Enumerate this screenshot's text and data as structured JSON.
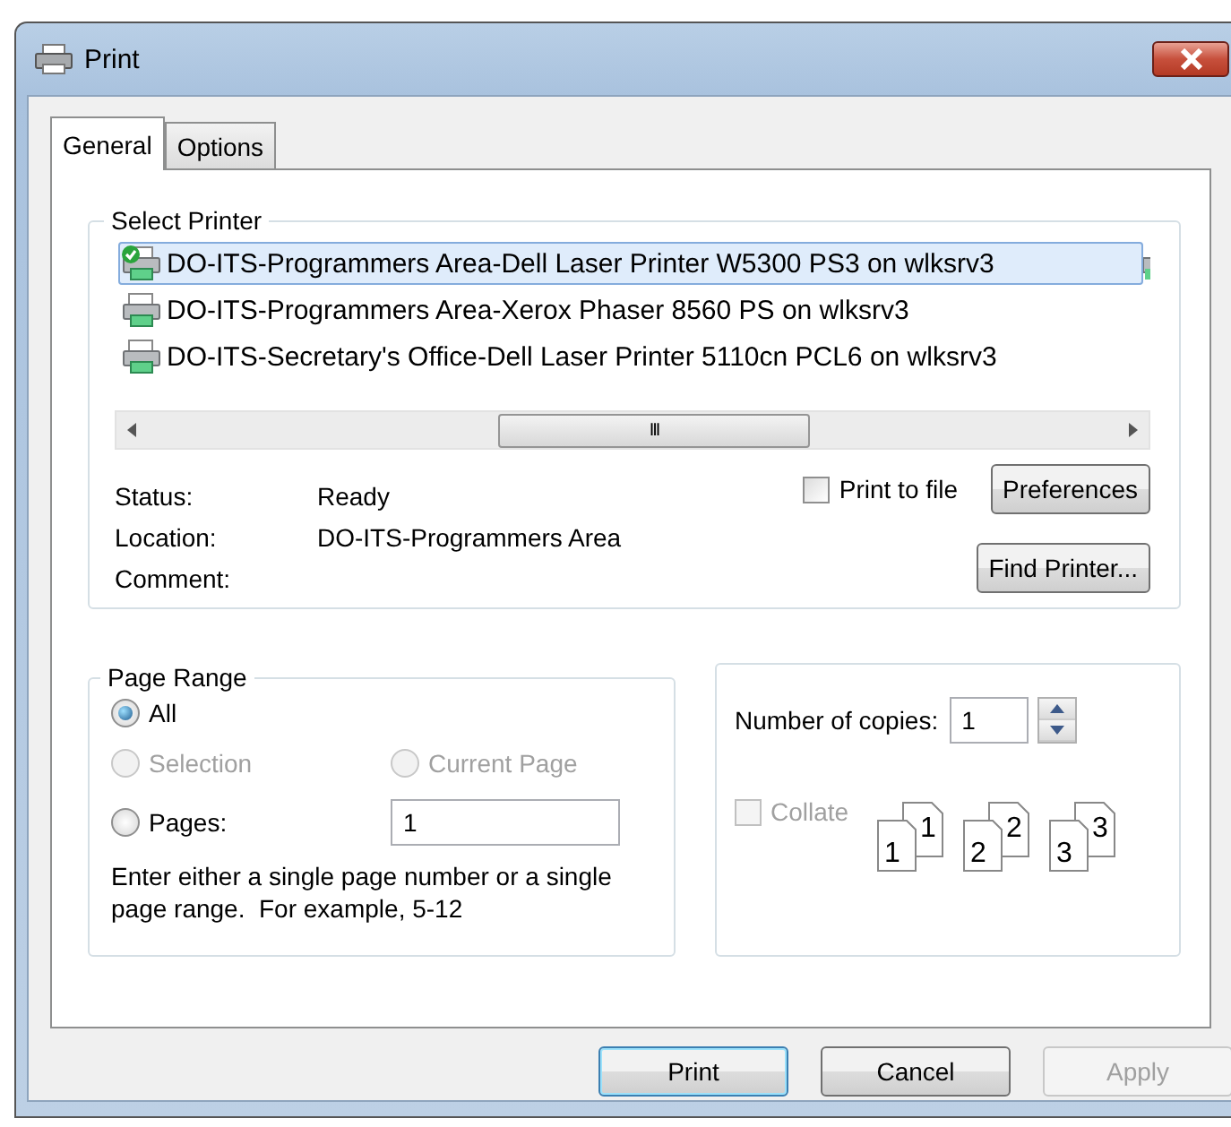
{
  "window": {
    "title": "Print"
  },
  "tabs": [
    {
      "label": "General",
      "selected": true
    },
    {
      "label": "Options",
      "selected": false
    }
  ],
  "select_printer": {
    "title": "Select Printer",
    "printers": [
      {
        "name": "DO-ITS-Programmers Area-Dell Laser Printer W5300 PS3 on wlksrv3",
        "selected": true,
        "default": true
      },
      {
        "name": "DO-ITS-Programmers Area-Xerox Phaser 8560 PS on wlksrv3",
        "selected": false,
        "default": false
      },
      {
        "name": "DO-ITS-Secretary's Office-Dell Laser Printer 5110cn PCL6 on wlksrv3",
        "selected": false,
        "default": false
      }
    ],
    "scroll_glyph": "III",
    "info": [
      {
        "label": "Status:",
        "value": "Ready"
      },
      {
        "label": "Location:",
        "value": "DO-ITS-Programmers Area"
      },
      {
        "label": "Comment:"
      }
    ],
    "print_to_file": {
      "label": "Print to file",
      "checked": false
    },
    "buttons": [
      "Preferences",
      "Find Printer..."
    ]
  },
  "page_range": {
    "title": "Page Range",
    "options": [
      {
        "label": "All",
        "selected": true,
        "disabled": false
      },
      {
        "label": "Selection",
        "selected": false,
        "disabled": true
      },
      {
        "label": "Current Page",
        "selected": false,
        "disabled": true
      },
      {
        "label": "Pages:",
        "selected": false,
        "disabled": false
      }
    ],
    "pages_value": "1",
    "hint": "Enter either a single page number or a single page range.  For example, 5-12"
  },
  "copies": {
    "label": "Number of copies:",
    "value": "1",
    "collate": {
      "label": "Collate",
      "checked": false,
      "disabled": true
    },
    "collate_pages": [
      {
        "back": "1",
        "front": "1"
      },
      {
        "back": "2",
        "front": "2"
      },
      {
        "back": "3",
        "front": "3"
      }
    ]
  },
  "buttons": [
    {
      "label": "Print",
      "default": true,
      "disabled": false
    },
    {
      "label": "Cancel",
      "default": false,
      "disabled": false
    },
    {
      "label": "Apply",
      "default": false,
      "disabled": true
    }
  ]
}
